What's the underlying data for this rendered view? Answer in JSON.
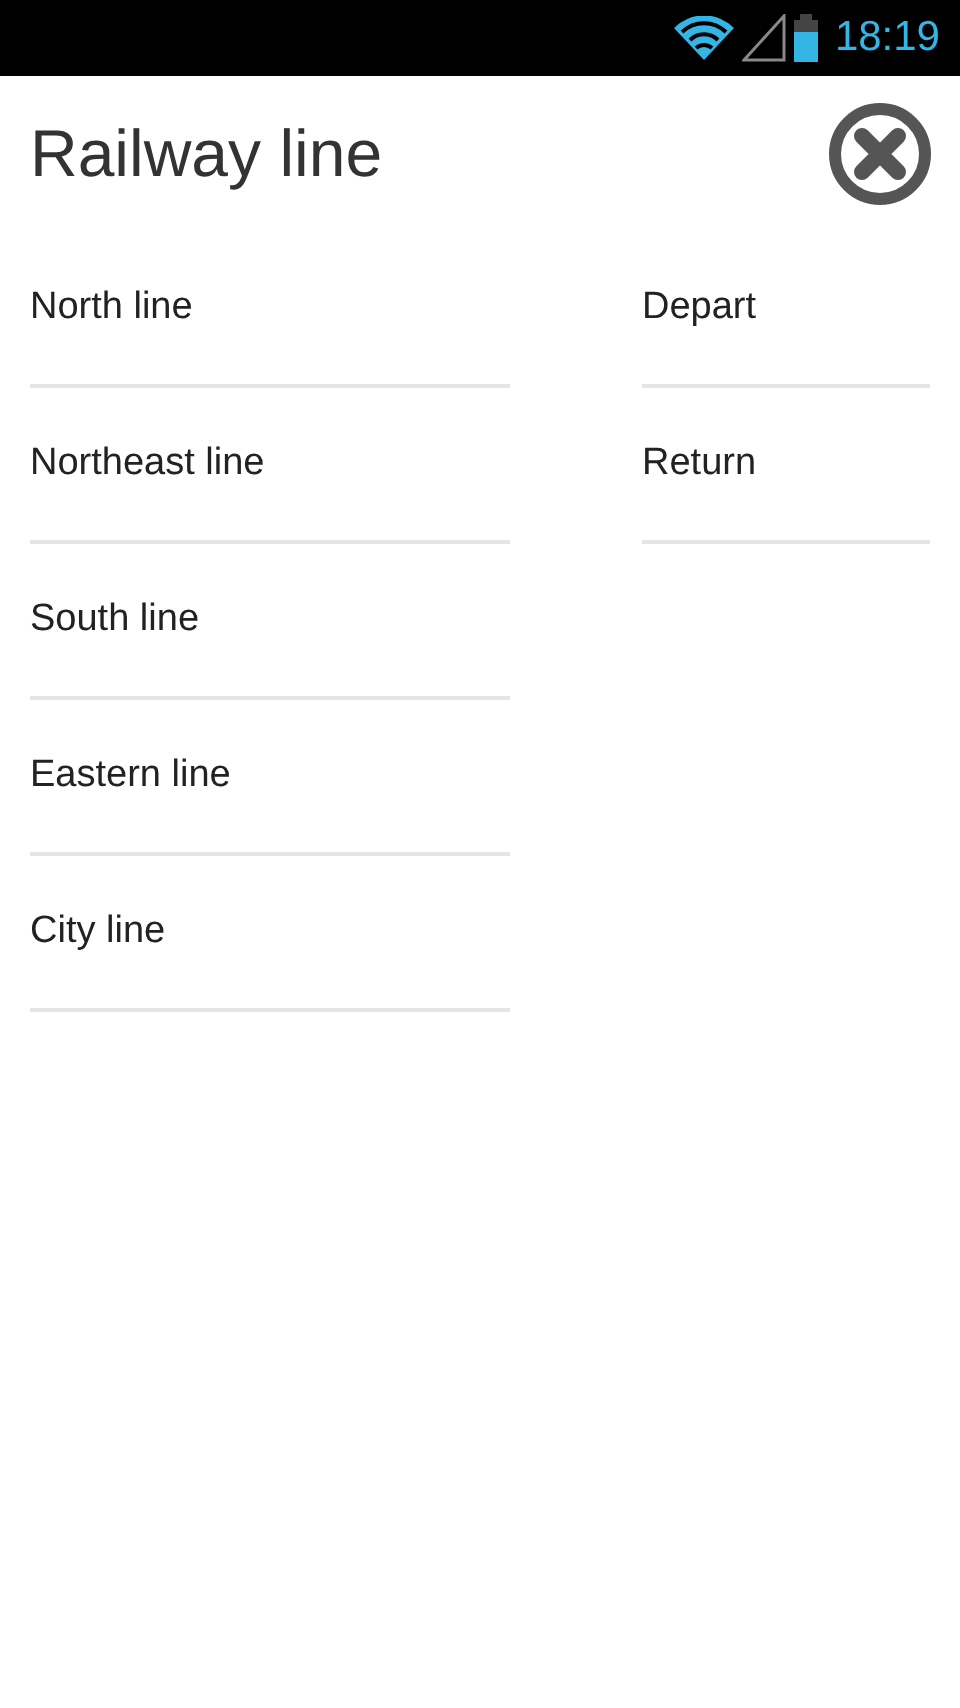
{
  "status_bar": {
    "time": "18:19"
  },
  "title": "Railway line",
  "lines": [
    {
      "label": "North line"
    },
    {
      "label": "Northeast line"
    },
    {
      "label": "South line"
    },
    {
      "label": "Eastern line"
    },
    {
      "label": "City line"
    }
  ],
  "directions": [
    {
      "label": "Depart"
    },
    {
      "label": "Return"
    }
  ]
}
